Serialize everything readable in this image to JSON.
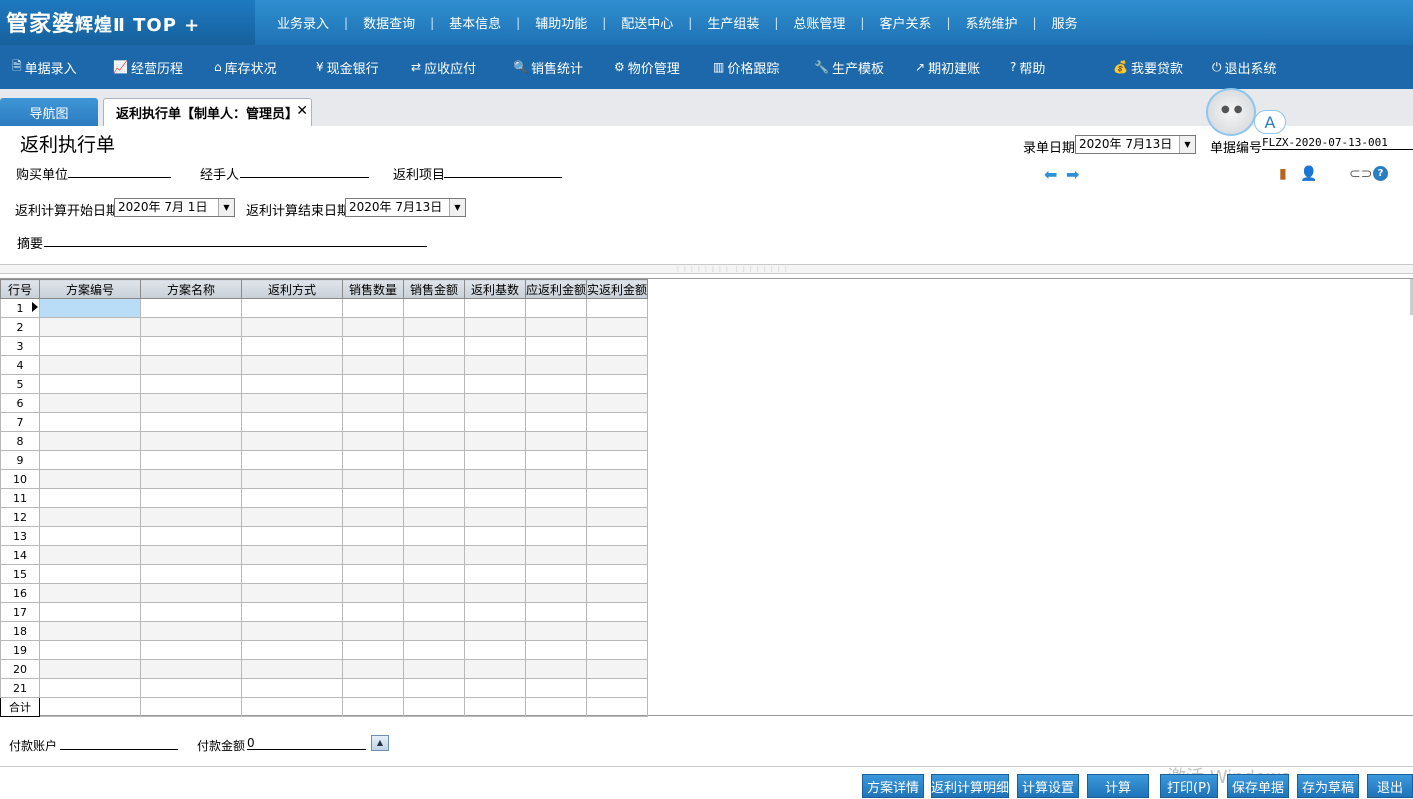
{
  "brand": {
    "name": "管家婆",
    "edition": "辉煌Ⅱ TOP +"
  },
  "top_menu": [
    "业务录入",
    "数据查询",
    "基本信息",
    "辅助功能",
    "配送中心",
    "生产组装",
    "总账管理",
    "客户关系",
    "系统维护",
    "服务"
  ],
  "toolbar": [
    {
      "icon": "document-icon",
      "glyph": "🗎",
      "label": "单据录入"
    },
    {
      "icon": "chart-line-icon",
      "glyph": "📈",
      "label": "经营历程"
    },
    {
      "icon": "home-icon",
      "glyph": "⌂",
      "label": "库存状况"
    },
    {
      "icon": "yen-icon",
      "glyph": "¥",
      "label": "现金银行"
    },
    {
      "icon": "exchange-icon",
      "glyph": "⇄",
      "label": "应收应付"
    },
    {
      "icon": "search-icon",
      "glyph": "🔍",
      "label": "销售统计"
    },
    {
      "icon": "gear-icon",
      "glyph": "⚙",
      "label": "物价管理"
    },
    {
      "icon": "bar-chart-icon",
      "glyph": "▥",
      "label": "价格跟踪"
    },
    {
      "icon": "wrench-icon",
      "glyph": "🔧",
      "label": "生产模板"
    },
    {
      "icon": "external-link-icon",
      "glyph": "↗",
      "label": "期初建账"
    },
    {
      "icon": "question-icon",
      "glyph": "?",
      "label": "帮助"
    },
    {
      "icon": "money-bag-icon",
      "glyph": "💰",
      "label": "我要贷款"
    },
    {
      "icon": "power-icon",
      "glyph": "⏻",
      "label": "退出系统"
    }
  ],
  "tabs": {
    "nav": "导航图",
    "doc": "返利执行单【制单人：管理员】",
    "close": "✕"
  },
  "assistant": {
    "badge": "A"
  },
  "form": {
    "title": "返利执行单",
    "entry_date_label": "录单日期",
    "entry_date": "2020年 7月13日",
    "doc_no_label": "单据编号",
    "doc_no": "FLZX-2020-07-13-001",
    "buyer_label": "购买单位",
    "handler_label": "经手人",
    "rebate_item_label": "返利项目",
    "start_date_label": "返利计算开始日期",
    "start_date": "2020年  7月  1日",
    "end_date_label": "返利计算结束日期",
    "end_date": "2020年  7月13日",
    "summary_label": "摘要"
  },
  "grid": {
    "columns": [
      "行号",
      "方案编号",
      "方案名称",
      "返利方式",
      "销售数量",
      "销售金额",
      "返利基数",
      "应返利金额",
      "实返利金额"
    ],
    "rows": [
      "1",
      "2",
      "3",
      "4",
      "5",
      "6",
      "7",
      "8",
      "9",
      "10",
      "11",
      "12",
      "13",
      "14",
      "15",
      "16",
      "17",
      "18",
      "19",
      "20",
      "21"
    ],
    "total_label": "合计"
  },
  "payment": {
    "account_label": "付款账户",
    "amount_label": "付款金额",
    "amount_value": "0"
  },
  "buttons": [
    "方案详情",
    "返利计算明细",
    "计算设置",
    "计算",
    "打印(P)",
    "保存单据",
    "存为草稿",
    "退出"
  ],
  "watermark": "激活 Windows"
}
